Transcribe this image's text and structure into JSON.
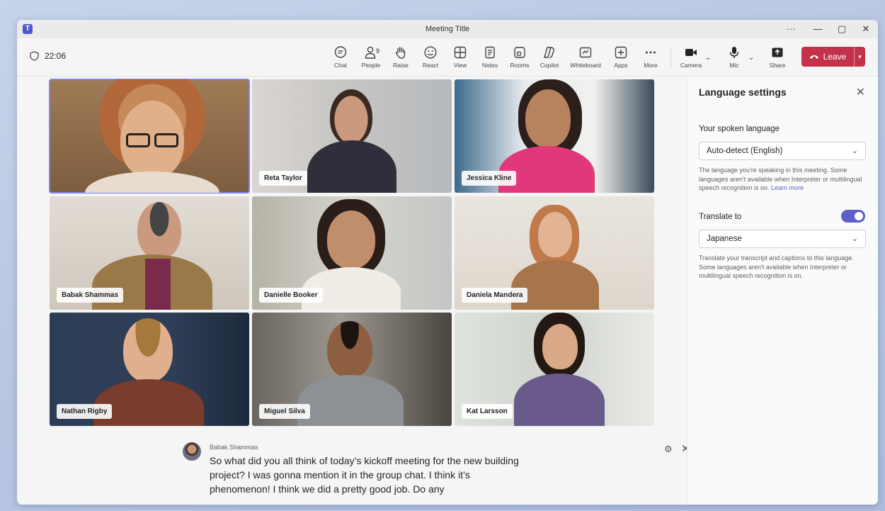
{
  "window": {
    "title": "Meeting Title",
    "more": "···",
    "minimize": "—",
    "maximize": "▢",
    "close": "✕"
  },
  "toolbar": {
    "timer": "22:06",
    "chat": "Chat",
    "people": "People",
    "people_count": "9",
    "raise": "Raise",
    "react": "React",
    "view": "View",
    "notes": "Notes",
    "rooms": "Rooms",
    "copilot": "Copilot",
    "whiteboard": "Whiteboard",
    "apps": "Apps",
    "more": "More",
    "camera": "Camera",
    "mic": "Mic",
    "share": "Share",
    "leave": "Leave"
  },
  "participants": [
    {
      "name": ""
    },
    {
      "name": "Reta Taylor"
    },
    {
      "name": "Jessica Kline"
    },
    {
      "name": "Babak Shammas"
    },
    {
      "name": "Danielle Booker"
    },
    {
      "name": "Daniela Mandera"
    },
    {
      "name": "Nathan Rigby"
    },
    {
      "name": "Miguel Silva"
    },
    {
      "name": "Kat Larsson"
    }
  ],
  "panel": {
    "title": "Language settings",
    "spoken_label": "Your spoken language",
    "spoken_value": "Auto-detect (English)",
    "spoken_hint": "The language you're speaking in this meeting. Some languages aren't available when Interpreter or multilingual speech recognition is on.",
    "learn_more": "Learn more",
    "translate_label": "Translate to",
    "translate_enabled": true,
    "translate_value": "Japanese",
    "translate_hint": "Translate your transcript and captions to this language. Some languages aren't available when Interpreter or multilingual speech recognition is on."
  },
  "caption": {
    "speaker": "Babak Shammas",
    "text": "So what did you all think of today’s kickoff meeting for the new building project? I was gonna mention it in the group chat. I think it’s phenomenon! I think we did a pretty good job. Do any"
  },
  "colors": {
    "accent": "#5b5fc7",
    "leave": "#c4314b",
    "active_outline": "#7f85f5"
  }
}
